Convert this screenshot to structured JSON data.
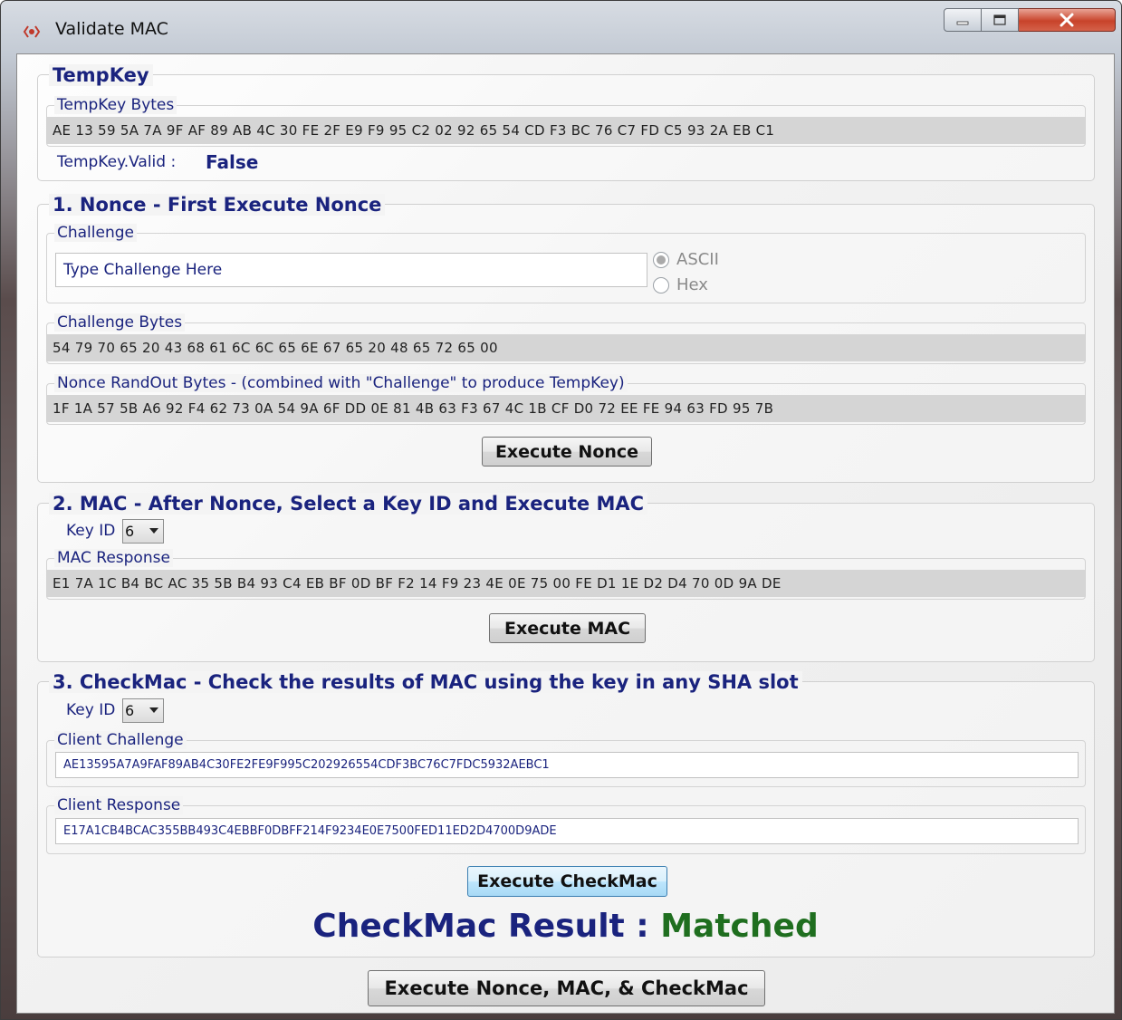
{
  "window": {
    "title": "Validate MAC",
    "min_icon": "minimize-icon",
    "max_icon": "maximize-icon",
    "close_icon": "close-icon",
    "close_label": "x"
  },
  "tempkey": {
    "title": "TempKey",
    "bytes_label": "TempKey Bytes",
    "bytes": "AE 13 59 5A 7A 9F AF 89 AB 4C 30 FE 2F E9 F9 95 C2 02 92 65 54 CD F3 BC 76 C7 FD C5 93 2A EB C1",
    "valid_label": "TempKey.Valid :",
    "valid_value": "False"
  },
  "nonce": {
    "title": "1. Nonce - First Execute Nonce",
    "challenge_label": "Challenge",
    "challenge_value": "Type Challenge Here",
    "radio_ascii": "ASCII",
    "radio_hex": "Hex",
    "selected_mode": "ASCII",
    "challenge_bytes_label": "Challenge Bytes",
    "challenge_bytes": "54 79 70 65 20 43 68 61 6C 6C 65 6E 67 65 20 48 65 72 65 00",
    "randout_label": "Nonce RandOut Bytes - (combined with \"Challenge\" to produce TempKey)",
    "randout_bytes": "1F 1A 57 5B A6 92 F4 62 73 0A 54 9A 6F DD 0E 81 4B 63 F3 67 4C 1B CF D0 72 EE FE 94 63 FD 95 7B",
    "button": "Execute Nonce"
  },
  "mac": {
    "title": "2. MAC - After Nonce, Select a Key ID and Execute MAC",
    "keyid_label": "Key ID",
    "keyid_value": "6",
    "response_label": "MAC Response",
    "response_bytes": "E1 7A 1C B4 BC AC 35 5B B4 93 C4 EB BF 0D BF F2 14 F9 23 4E 0E 75 00 FE D1 1E D2 D4 70 0D 9A DE",
    "button": "Execute MAC"
  },
  "checkmac": {
    "title": "3. CheckMac - Check the results of MAC using the key in any SHA slot",
    "keyid_label": "Key ID",
    "keyid_value": "6",
    "client_challenge_label": "Client Challenge",
    "client_challenge": "AE13595A7A9FAF89AB4C30FE2FE9F995C202926554CDF3BC76C7FDC5932AEBC1",
    "client_response_label": "Client Response",
    "client_response": "E17A1CB4BCAC355BB493C4EBBF0DBFF214F9234E0E7500FED11ED2D4700D9ADE",
    "button": "Execute CheckMac",
    "result_label": "CheckMac Result : ",
    "result_value": "Matched",
    "result_color": "#1f6e1f"
  },
  "footer": {
    "button": "Execute Nonce, MAC, & CheckMac"
  }
}
